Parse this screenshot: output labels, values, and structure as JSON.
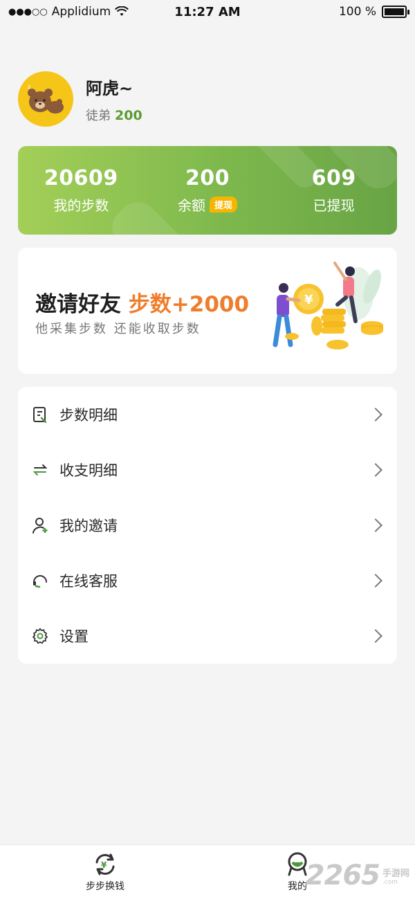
{
  "status_bar": {
    "signal": "●●●○○",
    "carrier": "Applidium",
    "time": "11:27 AM",
    "battery": "100 %"
  },
  "profile": {
    "nickname": "阿虎~",
    "disciple_label": "徒弟",
    "disciple_count": "200"
  },
  "stats": {
    "steps_value": "20609",
    "steps_label": "我的步数",
    "balance_value": "200",
    "balance_label": "余额",
    "withdraw_button": "提现",
    "withdrawn_value": "609",
    "withdrawn_label": "已提现"
  },
  "invite": {
    "title": "邀请好友",
    "highlight": "步数+2000",
    "subtitle": "他采集步数 还能收取步数",
    "coin_symbol": "¥"
  },
  "menu": {
    "items": [
      {
        "label": "步数明细",
        "icon": "steps-detail-icon"
      },
      {
        "label": "收支明细",
        "icon": "exchange-arrows-icon"
      },
      {
        "label": "我的邀请",
        "icon": "add-user-icon"
      },
      {
        "label": "在线客服",
        "icon": "headset-icon"
      },
      {
        "label": "设置",
        "icon": "gear-icon"
      }
    ]
  },
  "tabbar": {
    "tab_exchange": "步步换钱",
    "tab_mine": "我的"
  },
  "watermark": {
    "number": "2265",
    "suffix": ".com",
    "label": "手游网"
  },
  "colors": {
    "accent_green": "#7db84d",
    "accent_orange": "#ef7d2b",
    "badge_yellow": "#f7b500",
    "avatar_bg": "#f5c518"
  }
}
